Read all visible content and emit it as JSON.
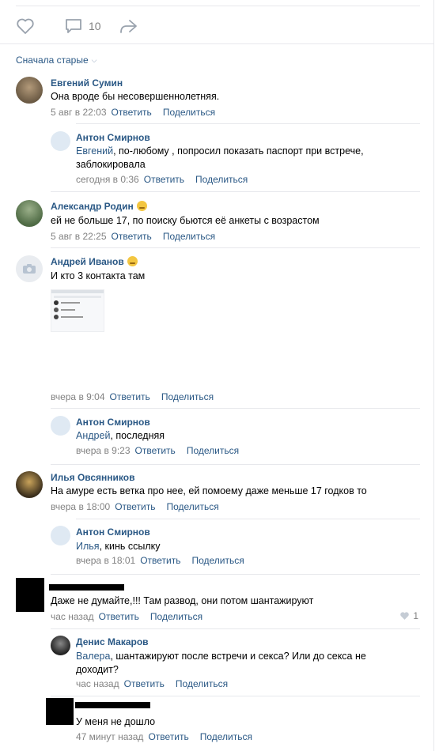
{
  "post_actions": {
    "comments_count": "10"
  },
  "sort": {
    "label": "Сначала старые"
  },
  "actions": {
    "reply": "Ответить",
    "share": "Поделиться"
  },
  "comments": [
    {
      "author": "Евгений Сумин",
      "text": "Она вроде бы несовершеннолетняя.",
      "time": "5 авг в 22:03"
    },
    {
      "author": "Антон Смирнов",
      "addressee": "Евгений",
      "text": ", по-любому , попросил показать паспорт при встрече, заблокировала",
      "time": "сегодня в 0:36"
    },
    {
      "author": "Александр Родин",
      "text": "ей не больше 17, по поиску бьются её анкеты с возрастом",
      "time": "5 авг в 22:25"
    },
    {
      "author": "Андрей Иванов",
      "text": "И кто 3 контакта там",
      "time": "вчера в 9:04"
    },
    {
      "author": "Антон Смирнов",
      "addressee": "Андрей",
      "text": ", последняя",
      "time": "вчера в 9:23"
    },
    {
      "author": "Илья Овсянников",
      "text": "На амуре есть ветка про нее, ей помоему даже меньше 17 годков то",
      "time": "вчера в 18:00"
    },
    {
      "author": "Антон Смирнов",
      "addressee": "Илья",
      "text": ", кинь ссылку",
      "time": "вчера в 18:01"
    },
    {
      "author": "",
      "text": "Даже не думайте,!!! Там развод, они потом шантажируют",
      "time": "час назад",
      "likes": "1"
    },
    {
      "author": "Денис Макаров",
      "addressee": "Валера",
      "text": ", шантажируют после встречи и секса? Или до секса не доходит?",
      "time": "час назад"
    },
    {
      "author": "",
      "text": "У меня не дошло",
      "time": "47 минут назад"
    }
  ]
}
